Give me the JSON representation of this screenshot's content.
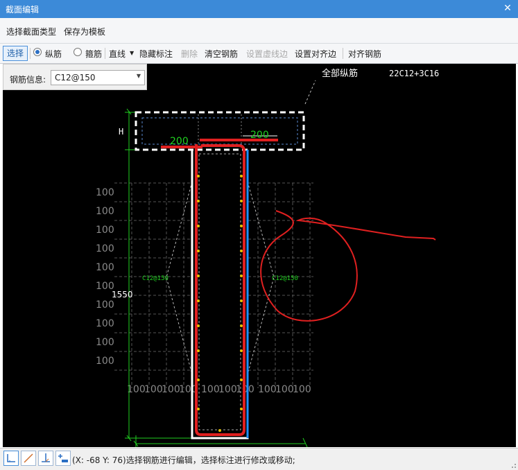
{
  "window": {
    "title": "截面编辑",
    "close_glyph": "✕"
  },
  "menu": {
    "items": [
      "选择截面类型",
      "保存为模板"
    ]
  },
  "toolbar": {
    "select_label": "选择",
    "radio_longitudinal": "纵筋",
    "radio_stirrup": "箍筋",
    "line_label": "直线",
    "hide_label": "隐藏标注",
    "delete_label": "删除",
    "clear_label": "清空钢筋",
    "dashed_edge_label": "设置虚线边",
    "align_edge_label": "设置对齐边",
    "align_rebar_label": "对齐钢筋"
  },
  "rebar_info": {
    "label": "钢筋信息:",
    "value": "C12@150"
  },
  "drawing": {
    "all_longitudinal_label": "全部纵筋",
    "all_longitudinal_value": "22C12+3C16",
    "flange_height_label": "H",
    "left_width": "200",
    "right_width": "200",
    "total_height": "1550",
    "left_side_bar": "C12@150",
    "right_side_bar": "C12@150",
    "grid_label": "100",
    "bottom_grid_labels": [
      "100",
      "100",
      "100",
      "100",
      "100",
      "100",
      "100",
      "100",
      "100",
      "100",
      "100",
      "100"
    ],
    "left_grid_labels": [
      "100",
      "100",
      "100",
      "100",
      "100",
      "100",
      "100",
      "100",
      "100",
      "100",
      "100"
    ],
    "colors": {
      "background": "#000000",
      "outline": "#ffffff",
      "stirrup": "#e02020",
      "dimension": "#20d020",
      "rebar_blue": "#1e90ff",
      "point": "#e6c200"
    }
  },
  "status": {
    "message": "(X: -68 Y: 76)选择钢筋进行编辑，选择标注进行修改或移动;",
    "tools": [
      "ortho-icon",
      "line-icon",
      "snap-icon",
      "dimension-icon"
    ]
  }
}
